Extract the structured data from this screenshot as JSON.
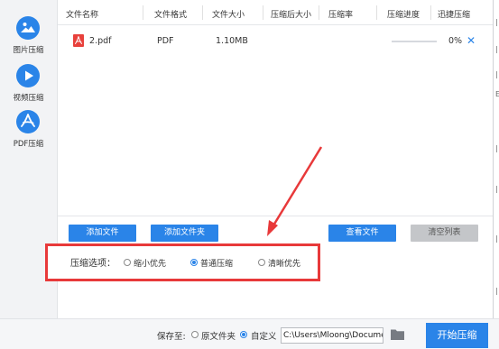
{
  "sidebar": {
    "items": [
      {
        "label": "图片压缩",
        "icon": "image-icon"
      },
      {
        "label": "视频压缩",
        "icon": "play-icon"
      },
      {
        "label": "PDF压缩",
        "icon": "pdf-icon"
      }
    ]
  },
  "table": {
    "columns": [
      "文件名称",
      "文件格式",
      "文件大小",
      "压缩后大小",
      "压缩率",
      "压缩进度",
      "迅捷压缩"
    ],
    "rows": [
      {
        "name": "2.pdf",
        "format": "PDF",
        "size": "1.10MB",
        "compressed_size": "",
        "ratio": "",
        "progress_text": "0%",
        "progress": 0,
        "remove_icon": "close-icon"
      }
    ]
  },
  "toolbar": {
    "add_file": "添加文件",
    "add_folder": "添加文件夹",
    "view_files": "查看文件",
    "clear_list": "清空列表"
  },
  "options": {
    "label": "压缩选项：",
    "choices": [
      "缩小优先",
      "普通压缩",
      "清晰优先"
    ],
    "selected": "普通压缩"
  },
  "bottom": {
    "save_to_label": "保存至:",
    "save_options": [
      "原文件夹",
      "自定义"
    ],
    "save_selected": "自定义",
    "path": "C:\\Users\\Mloong\\Documents",
    "start_button": "开始压缩",
    "folder_icon": "folder-icon"
  },
  "right_edge": {
    "chars": [
      "|",
      "|",
      "|",
      "E",
      "|",
      "|",
      "|",
      "|"
    ]
  },
  "colors": {
    "accent": "#2a84e8",
    "highlight_box": "#e8393a",
    "arrow": "#e8393a"
  }
}
